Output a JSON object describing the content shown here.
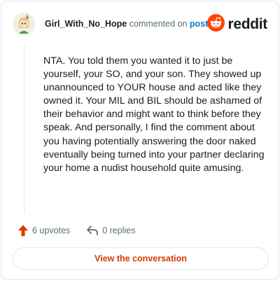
{
  "comment": {
    "username": "Girl_With_No_Hope",
    "verb": "commented on",
    "link_label": "post",
    "body": "NTA. You told them you wanted it to just be yourself, your SO, and your son. They showed up unannounced to YOUR house and acted like they owned it. Your MIL and BIL should be ashamed of their behavior and might want to think before they speak. And personally, I find the comment about you having potentially answering the door naked eventually being turned into your partner declaring your home a nudist household quite amusing."
  },
  "brand": {
    "name": "reddit",
    "icon": "reddit-logo-icon",
    "color": "#ff4500"
  },
  "actions": {
    "upvotes_label": "6 upvotes",
    "upvote_icon": "upvote-arrow-icon",
    "upvote_color": "#d93a00",
    "replies_label": "0 replies",
    "reply_icon": "reply-arrow-icon"
  },
  "cta": {
    "label": "View the conversation",
    "color": "#d93a00"
  }
}
